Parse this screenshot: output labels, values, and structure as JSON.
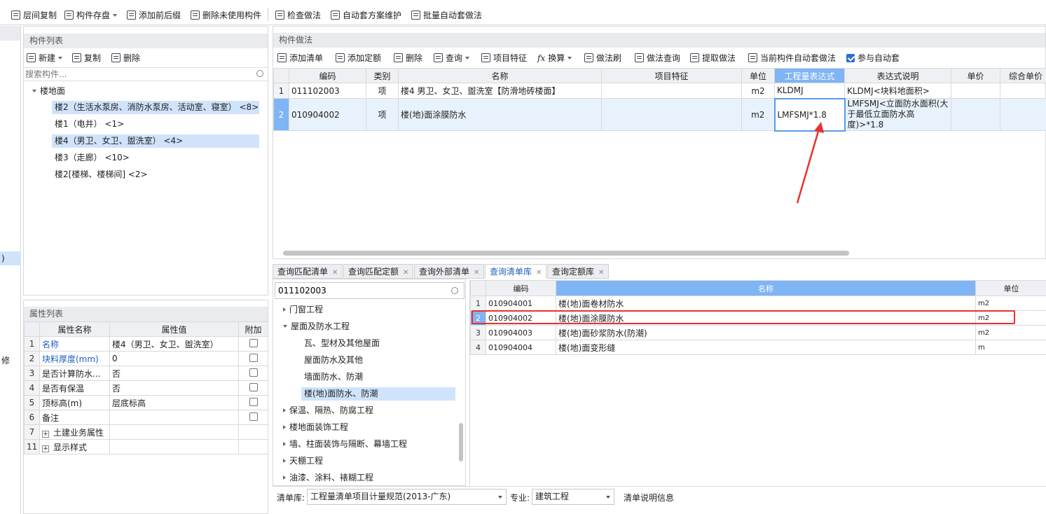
{
  "toolbar": {
    "floor_copy": "层间复制",
    "component_save": "构件存盘",
    "add_prefix_suffix": "添加前后缀",
    "delete_unused": "删除未使用构件",
    "check_method": "检查做法",
    "auto_scheme": "自动套方案维护",
    "batch_auto": "批量自动套做法"
  },
  "component_list": {
    "title": "构件列表",
    "new_label": "新建",
    "copy_label": "复制",
    "delete_label": "删除",
    "search_placeholder": "搜索构件...",
    "root": "楼地面",
    "items": [
      "楼2（生活水泵房、消防水泵房、活动室、寝室） <8>",
      "楼1（电井） <1>",
      "楼4（男卫、女卫、盥洗室） <4>",
      "楼3（走廊） <10>",
      "楼2[楼梯、楼梯间] <2>"
    ]
  },
  "property_list": {
    "title": "属性列表",
    "headers": [
      "属性名称",
      "属性值",
      "附加"
    ],
    "rows": [
      {
        "num": "1",
        "name": "名称",
        "value": "楼4（男卫、女卫、盥洗室）",
        "check": false
      },
      {
        "num": "2",
        "name": "块料厚度(mm)",
        "value": "0",
        "check": false
      },
      {
        "num": "3",
        "name": "是否计算防水...",
        "value": "否",
        "check": false
      },
      {
        "num": "4",
        "name": "是否有保温",
        "value": "否",
        "check": false
      },
      {
        "num": "5",
        "name": "顶标高(m)",
        "value": "层底标高",
        "check": false
      },
      {
        "num": "6",
        "name": "备注",
        "value": "",
        "check": false
      },
      {
        "num": "7",
        "name": "土建业务属性",
        "value": "",
        "check": null
      },
      {
        "num": "11",
        "name": "显示样式",
        "value": "",
        "check": null
      }
    ]
  },
  "left_edge": {
    "text1": ")",
    "text2": "修"
  },
  "method_panel": {
    "title": "构件做法",
    "tools": {
      "add_list": "添加清单",
      "add_quota": "添加定额",
      "delete": "删除",
      "query": "查询",
      "item_feature": "项目特征",
      "convert": "换算",
      "method_brush": "做法刷",
      "method_query": "做法查询",
      "extract": "提取做法",
      "current_auto": "当前构件自动套做法",
      "join_auto": "参与自动套"
    },
    "headers": [
      "编码",
      "类别",
      "名称",
      "项目特征",
      "单位",
      "工程量表达式",
      "表达式说明",
      "单价",
      "综合单价"
    ],
    "rows": [
      {
        "num": "1",
        "code": "011102003",
        "type": "项",
        "name": "楼4 男卫、女卫、盥洗室【防滑地砖楼面】",
        "feature": "",
        "unit": "m2",
        "expr": "KLDMJ",
        "expr_desc": "KLDMJ<块料地面积>"
      },
      {
        "num": "2",
        "code": "010904002",
        "type": "项",
        "name": "楼(地)面涂膜防水",
        "feature": "",
        "unit": "m2",
        "expr": "LMFSMJ*1.8",
        "expr_desc": "LMFSMJ<立面防水面积(大于最低立面防水高度)>*1.8"
      }
    ]
  },
  "tabs": [
    "查询匹配清单",
    "查询匹配定额",
    "查询外部清单",
    "查询清单库",
    "查询定额库"
  ],
  "library": {
    "search_value": "011102003",
    "tree": [
      {
        "label": "门窗工程",
        "expanded": false,
        "level": 0
      },
      {
        "label": "屋面及防水工程",
        "expanded": true,
        "level": 0
      },
      {
        "label": "瓦、型材及其他屋面",
        "level": 1
      },
      {
        "label": "屋面防水及其他",
        "level": 1
      },
      {
        "label": "墙面防水、防潮",
        "level": 1
      },
      {
        "label": "楼(地)面防水、防潮",
        "level": 1,
        "selected": true
      },
      {
        "label": "保温、隔热、防腐工程",
        "expanded": false,
        "level": 0
      },
      {
        "label": "楼地面装饰工程",
        "expanded": false,
        "level": 0
      },
      {
        "label": "墙、柱面装饰与隔断、幕墙工程",
        "expanded": false,
        "level": 0
      },
      {
        "label": "天棚工程",
        "expanded": false,
        "level": 0
      },
      {
        "label": "油漆、涂料、裱糊工程",
        "expanded": false,
        "level": 0
      }
    ],
    "headers": [
      "编码",
      "名称",
      "单位"
    ],
    "rows": [
      {
        "num": "1",
        "code": "010904001",
        "name": "楼(地)面卷材防水",
        "unit": "m2"
      },
      {
        "num": "2",
        "code": "010904002",
        "name": "楼(地)面涂膜防水",
        "unit": "m2"
      },
      {
        "num": "3",
        "code": "010904003",
        "name": "楼(地)面砂浆防水(防潮)",
        "unit": "m2"
      },
      {
        "num": "4",
        "code": "010904004",
        "name": "楼(地)面变形缝",
        "unit": "m"
      }
    ]
  },
  "bottom_bar": {
    "lib_label": "清单库:",
    "lib_value": "工程量清单项目计量规范(2013-广东)",
    "major_label": "专业:",
    "major_value": "建筑工程",
    "info_label": "清单说明信息"
  },
  "colors": {
    "accent": "#1f5fbf",
    "selection": "#cfe3fb",
    "highlight_header": "#7fb4f5",
    "annotation": "#e8322d"
  }
}
